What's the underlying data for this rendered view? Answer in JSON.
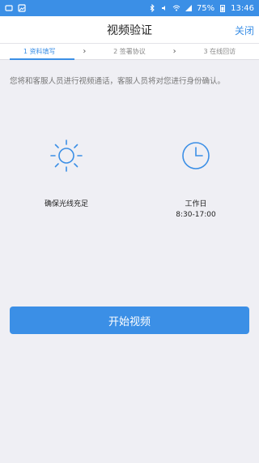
{
  "status_bar": {
    "battery": "75%",
    "time": "13:46"
  },
  "nav": {
    "title": "视频验证",
    "close_label": "关闭"
  },
  "steps": [
    {
      "label": "1 资料填写"
    },
    {
      "label": "2 签署协议"
    },
    {
      "label": "3 在线回访"
    }
  ],
  "intro_text": "您将和客服人员进行视频通话，客服人员将对您进行身份确认。",
  "features": {
    "light": {
      "label": "确保光线充足"
    },
    "time": {
      "label": "工作日",
      "hours": "8:30-17:00"
    }
  },
  "start_button": {
    "label": "开始视频"
  },
  "colors": {
    "accent": "#3b8fe6",
    "background": "#efeff4"
  }
}
